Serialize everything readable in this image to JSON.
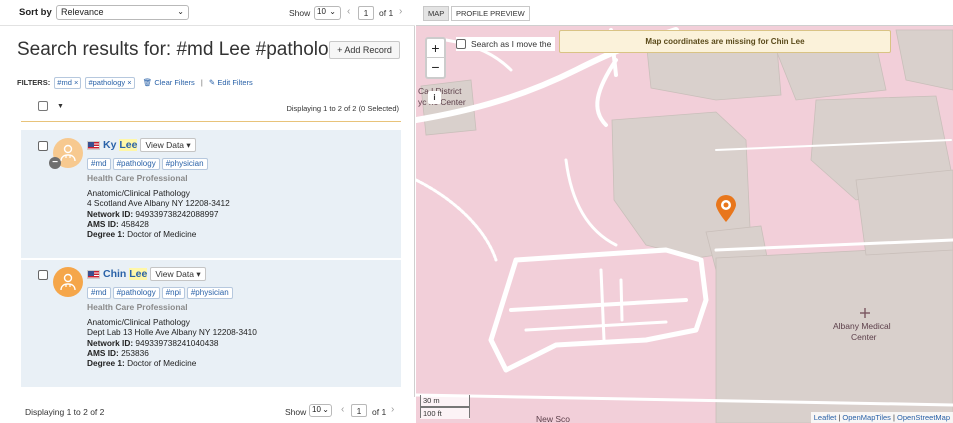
{
  "sort": {
    "label": "Sort by",
    "value": "Relevance"
  },
  "top_pager": {
    "show_label": "Show",
    "per_page": "10",
    "page": "1",
    "of": "of 1"
  },
  "title": "Search results for: #md Lee #pathology",
  "add_record": "+ Add Record",
  "filters": {
    "label": "FILTERS:",
    "chips": [
      "#md ×",
      "#pathology ×"
    ],
    "clear": "Clear Filters",
    "sep": "|",
    "edit": "Edit Filters"
  },
  "displaying_top": "Displaying 1 to 2 of 2 (0 Selected)",
  "results": [
    {
      "first": "Ky",
      "last": "Lee",
      "view": "View Data",
      "tags": [
        "#md",
        "#pathology",
        "#physician"
      ],
      "role": "Health Care Professional",
      "specialty": "Anatomic/Clinical Pathology",
      "address": "4  Scotland Ave Albany NY 12208-3412",
      "network_label": "Network ID:",
      "network_id": "949339738242088997",
      "ams_label": "AMS ID:",
      "ams_id": "458428",
      "degree_label": "Degree 1:",
      "degree": "Doctor of Medicine"
    },
    {
      "first": "Chin",
      "last": "Lee",
      "view": "View Data",
      "tags": [
        "#md",
        "#pathology",
        "#npi",
        "#physician"
      ],
      "role": "Health Care Professional",
      "specialty": "Anatomic/Clinical Pathology",
      "address": "Dept Lab 13 Holle Ave Albany NY 12208-3410",
      "network_label": "Network ID:",
      "network_id": "949339738241040438",
      "ams_label": "AMS ID:",
      "ams_id": "253836",
      "degree_label": "Degree 1:",
      "degree": "Doctor of Medicine"
    }
  ],
  "displaying_bottom": "Displaying 1 to 2 of 2",
  "bottom_pager": {
    "show_label": "Show",
    "per_page": "10",
    "page": "1",
    "of": "of 1"
  },
  "map": {
    "tabs": [
      "MAP",
      "PROFILE PREVIEW"
    ],
    "search_move": "Search as I move the",
    "warning": "Map coordinates are missing for Chin Lee",
    "zoom_in": "+",
    "zoom_out": "−",
    "info": "i",
    "labels": {
      "district_1": "Ca   l District",
      "district_2": "yc   ric Center",
      "albany_1": "Albany Medical",
      "albany_2": "Center",
      "bottom": "New Sco"
    },
    "scale_m": "30 m",
    "scale_ft": "100 ft",
    "attribution": {
      "a": "Leaflet",
      "sep": " | ",
      "b": "OpenMapTiles",
      "c": "OpenStreetMap"
    }
  },
  "colors": {
    "accent": "#2a62a8",
    "marker": "#e8761c",
    "map_bg": "#f2cfd9",
    "building": "#d9d0cc"
  }
}
